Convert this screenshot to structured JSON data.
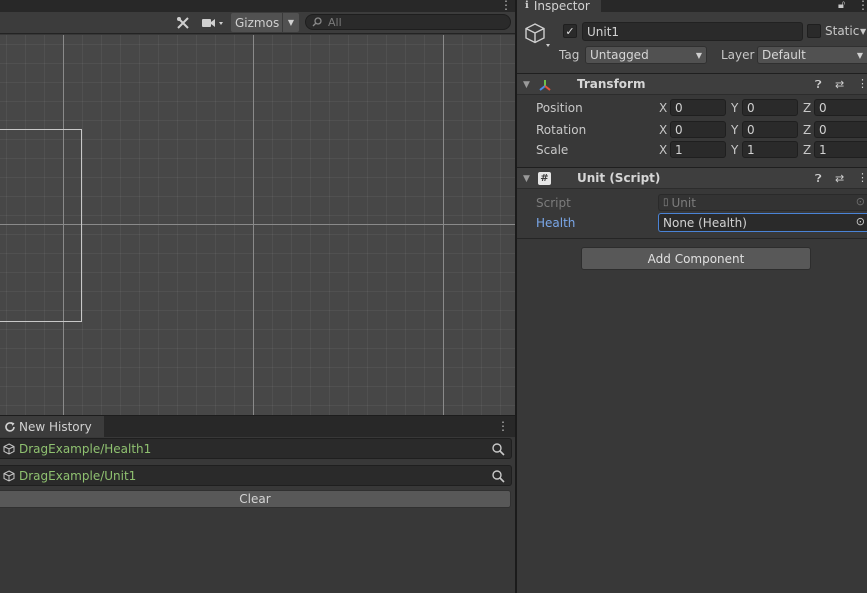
{
  "scene": {
    "gizmos_label": "Gizmos",
    "search_placeholder": "All"
  },
  "history": {
    "tab_label": "New History",
    "items": [
      {
        "label": "DragExample/Health1"
      },
      {
        "label": "DragExample/Unit1"
      }
    ],
    "clear_label": "Clear"
  },
  "inspector": {
    "tab_label": "Inspector",
    "object": {
      "name": "Unit1",
      "active": true,
      "static_label": "Static",
      "tag_label": "Tag",
      "tag_value": "Untagged",
      "layer_label": "Layer",
      "layer_value": "Default"
    },
    "transform": {
      "title": "Transform",
      "rows": [
        {
          "label": "Position",
          "x": "0",
          "y": "0",
          "z": "0"
        },
        {
          "label": "Rotation",
          "x": "0",
          "y": "0",
          "z": "0"
        },
        {
          "label": "Scale",
          "x": "1",
          "y": "1",
          "z": "1"
        }
      ],
      "axis_x": "X",
      "axis_y": "Y",
      "axis_z": "Z"
    },
    "unit_script": {
      "title": "Unit (Script)",
      "script_label": "Script",
      "script_value": "Unit",
      "health_label": "Health",
      "health_value": "None (Health)"
    },
    "add_component_label": "Add Component"
  },
  "colors": {
    "link_blue": "#7aa7e9",
    "history_green": "#8fc170",
    "panel_bg": "#383838"
  }
}
